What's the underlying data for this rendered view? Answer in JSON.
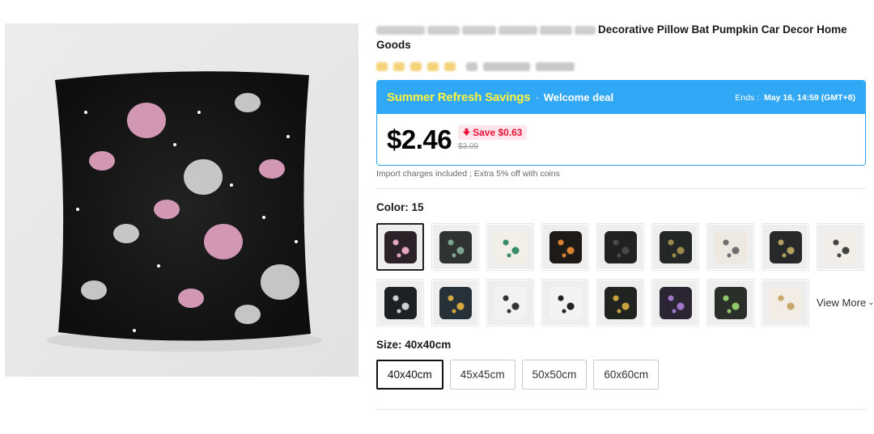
{
  "product": {
    "title": "Decorative Pillow Bat Pumpkin Car Decor Home Goods"
  },
  "deal": {
    "name": "Summer Refresh Savings",
    "separator": "·",
    "subtitle": "Welcome deal",
    "ends_label": "Ends :",
    "ends_value": "May 16, 14:59 (GMT+8)",
    "price": "$2.46",
    "save_label": "Save $0.63",
    "original_price": "$3.09"
  },
  "import_note": "Import charges included ; Extra 5% off with coins",
  "color": {
    "label": "Color: 15",
    "view_more": "View More",
    "swatches": [
      {
        "color": "#2a2226",
        "accent": "#e7a6c4"
      },
      {
        "color": "#2f3433",
        "accent": "#7fa592"
      },
      {
        "color": "#f2efe6",
        "accent": "#3a8a6c"
      },
      {
        "color": "#1d1a18",
        "accent": "#d9822f"
      },
      {
        "color": "#1f2221",
        "accent": "#4a4a4a"
      },
      {
        "color": "#232826",
        "accent": "#9c8a4d"
      },
      {
        "color": "#ede9e0",
        "accent": "#6e6e6e"
      },
      {
        "color": "#26282a",
        "accent": "#b4a15e"
      },
      {
        "color": "#f1eeea",
        "accent": "#444444"
      },
      {
        "color": "#1e2124",
        "accent": "#cfcfcf"
      },
      {
        "color": "#26313a",
        "accent": "#d6a73e"
      },
      {
        "color": "#f2f2f2",
        "accent": "#333333"
      },
      {
        "color": "#f3f3f3",
        "accent": "#222222"
      },
      {
        "color": "#202320",
        "accent": "#c6a440"
      },
      {
        "color": "#2a2433",
        "accent": "#a175c9"
      },
      {
        "color": "#2a2f29",
        "accent": "#8fc96a"
      },
      {
        "color": "#1f2320",
        "accent": "#e9e9e9"
      },
      {
        "color": "#f2ece4",
        "accent": "#c8a66a"
      }
    ]
  },
  "size": {
    "label": "Size: 40x40cm",
    "options": [
      "40x40cm",
      "45x45cm",
      "50x50cm",
      "60x60cm"
    ]
  },
  "colors": {
    "deal_blue": "#31a8f6",
    "deal_name_yellow": "#fff33d",
    "save_red": "#e8113a",
    "pillow_black": "#1a1a1a",
    "pillow_pink": "#e7a6c4"
  }
}
